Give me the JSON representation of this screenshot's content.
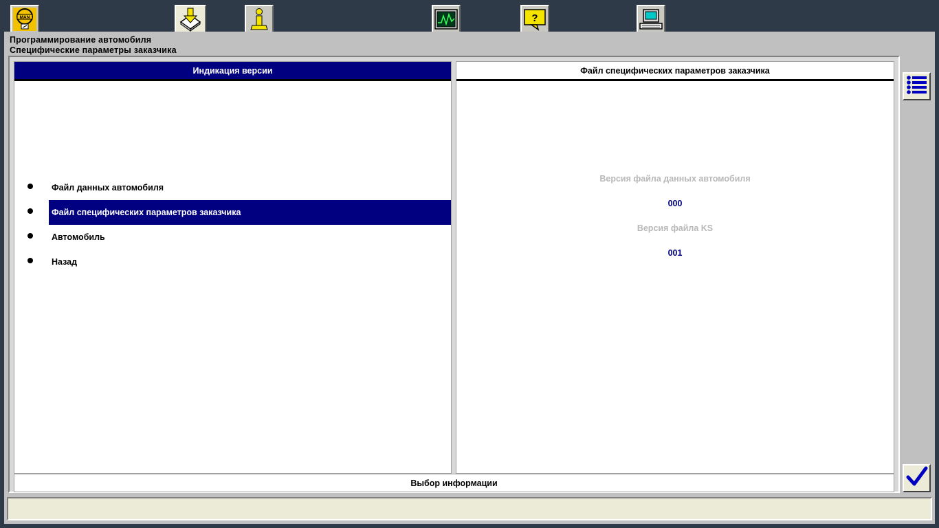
{
  "header": {
    "title": "Программирование автомобиля",
    "subtitle": "Специфические параметры заказчика"
  },
  "toolbar": {
    "icons": [
      "man-logo-icon",
      "download-icon",
      "info-person-icon",
      "oscilloscope-icon",
      "help-icon",
      "computer-icon"
    ]
  },
  "left_panel": {
    "header": "Индикация версии",
    "items": [
      {
        "label": "Файл данных автомобиля",
        "selected": false
      },
      {
        "label": "Файл специфических параметров заказчика",
        "selected": true
      },
      {
        "label": "Автомобиль",
        "selected": false
      },
      {
        "label": "Назад",
        "selected": false
      }
    ]
  },
  "right_panel": {
    "header": "Файл специфических параметров заказчика",
    "vehicle_file_label": "Версия файла данных автомобиля",
    "vehicle_file_value": "000",
    "ks_file_label": "Версия файла KS",
    "ks_file_value": "001"
  },
  "footer": {
    "label": "Выбор информации"
  },
  "side_buttons": {
    "icons": [
      "list-icon",
      "checkmark-icon"
    ]
  },
  "colors": {
    "selection": "#000080",
    "background": "#c0c0c0",
    "disabled_text": "#b8b8b8"
  }
}
